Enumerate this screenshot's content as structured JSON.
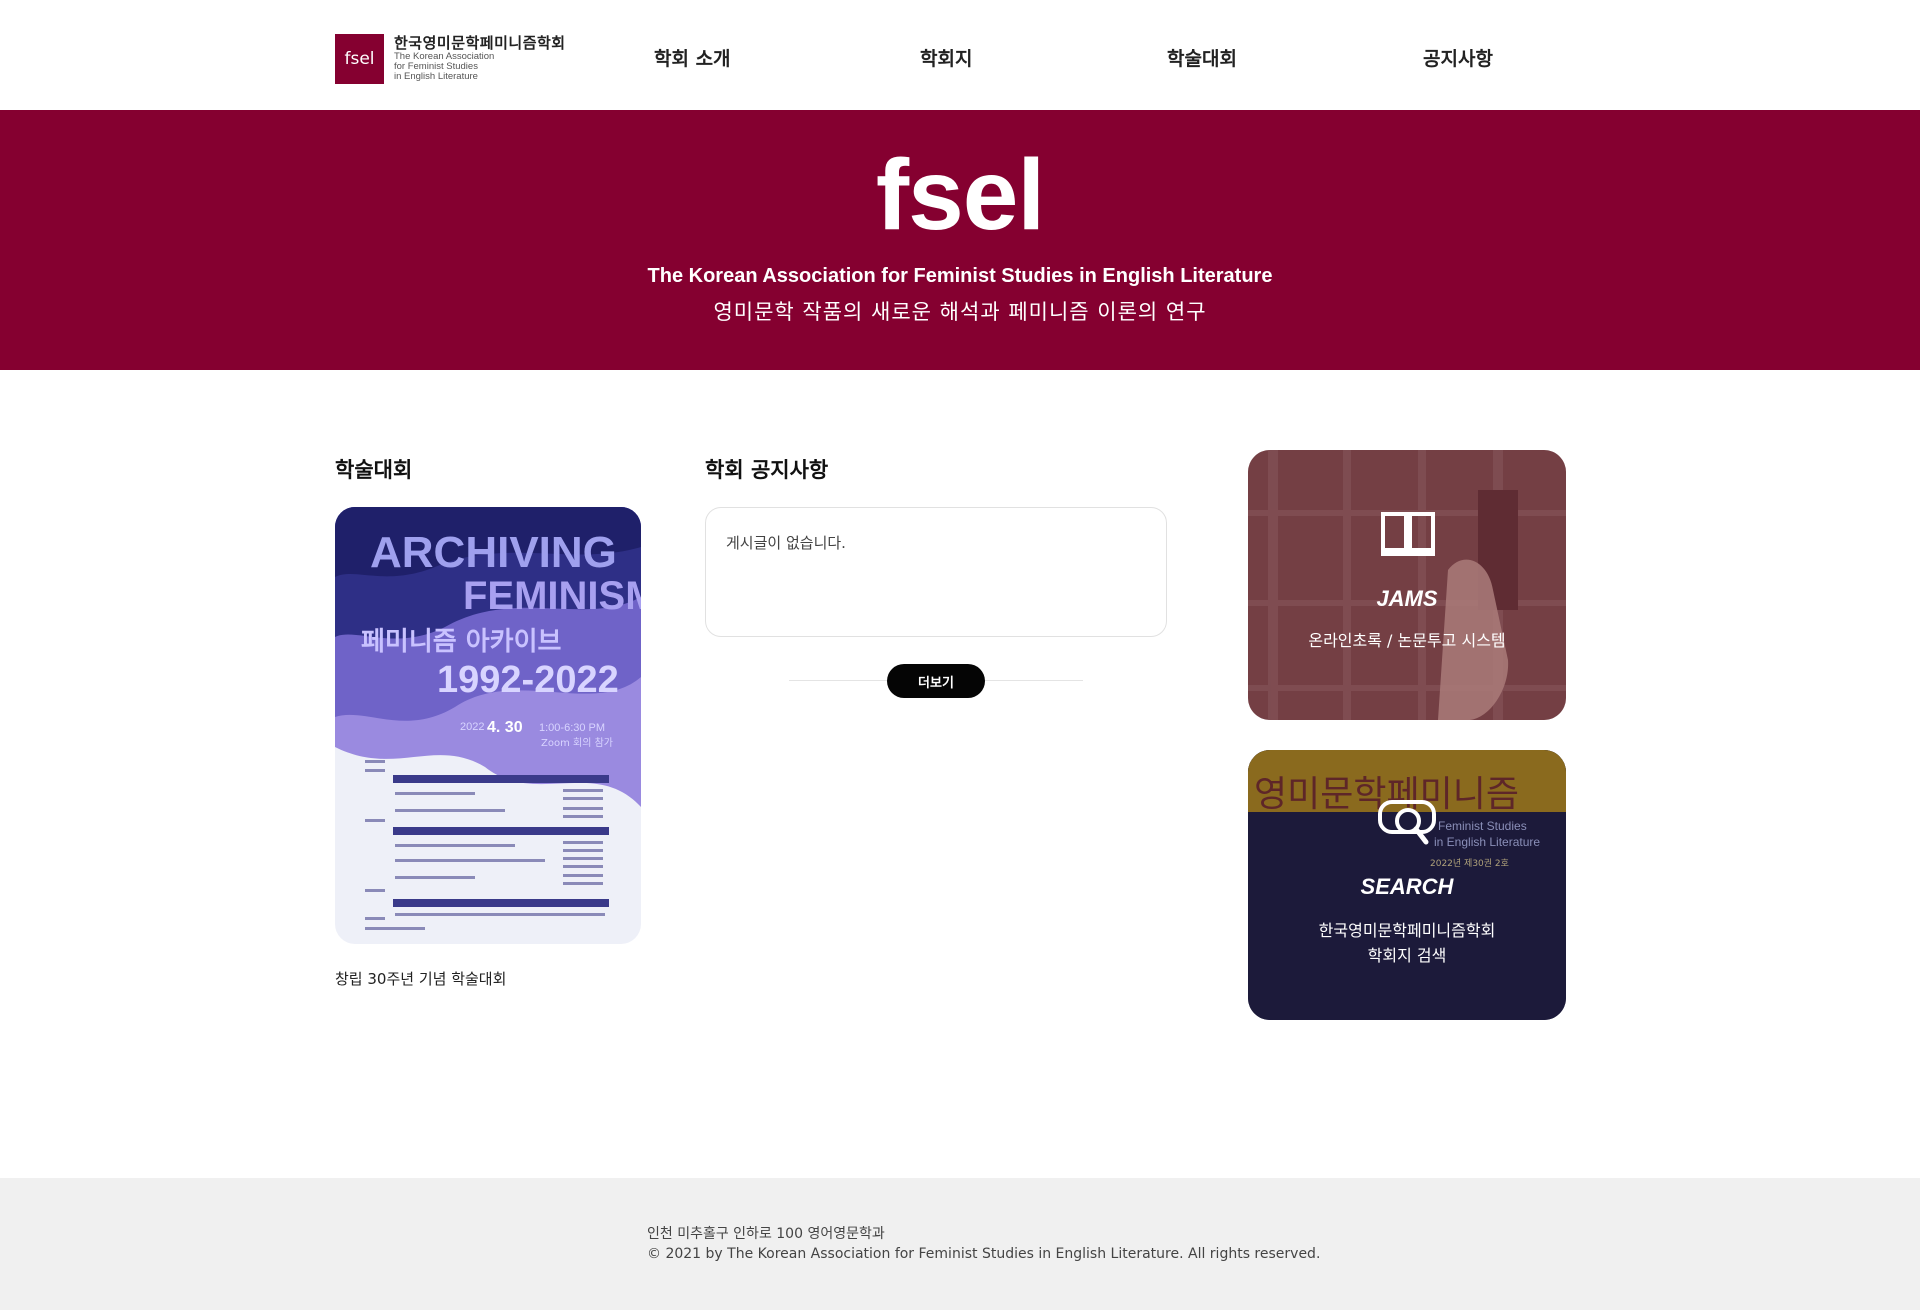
{
  "header": {
    "logo_mark": "fsel",
    "logo_kor": "한국영미문학페미니즘학회",
    "logo_eng_1": "The Korean Association",
    "logo_eng_2": "for Feminist Studies",
    "logo_eng_3": "in English Literature",
    "nav": [
      "학회 소개",
      "학회지",
      "학술대회",
      "공지사항"
    ]
  },
  "banner": {
    "logo": "fsel",
    "title_eng": "The Korean Association for Feminist Studies in English Literature",
    "title_kor": "영미문학 작품의 새로운 해석과 페미니즘 이론의 연구"
  },
  "conference": {
    "section_title": "학술대회",
    "poster_line1": "ARCHIVING",
    "poster_line2": "FEMINISM",
    "poster_line3": "페미니즘 아카이브",
    "poster_years": "1992-2022",
    "poster_date_year": "2022",
    "poster_date": "4. 30",
    "poster_time": "1:00-6:30 PM",
    "poster_venue": "Zoom 회의 참가",
    "caption": "창립 30주년 기념 학술대회"
  },
  "notice": {
    "section_title": "학회 공지사항",
    "empty_message": "게시글이 없습니다.",
    "more_button": "더보기"
  },
  "quick_links": {
    "jams": {
      "title": "JAMS",
      "desc": "온라인초록 / 논문투고 시스템",
      "icon": "book-icon"
    },
    "search": {
      "title": "SEARCH",
      "desc_1": "한국영미문학페미니즘학회",
      "desc_2": "학회지 검색",
      "icon": "search-icon",
      "bg_kor": "영미문학페미니즘",
      "bg_eng_1": "Feminist Studies",
      "bg_eng_2": "in English Literature",
      "bg_issue": "2022년 제30권 2호"
    }
  },
  "footer": {
    "address": "인천 미추홀구 인하로 100 영어영문학과",
    "copyright": "© 2021 by The Korean Association for Feminist Studies in English Literature. All rights reserved."
  },
  "colors": {
    "brand": "#850030",
    "navy": "#1c1a3a",
    "footer_bg": "#f0f0f0"
  }
}
